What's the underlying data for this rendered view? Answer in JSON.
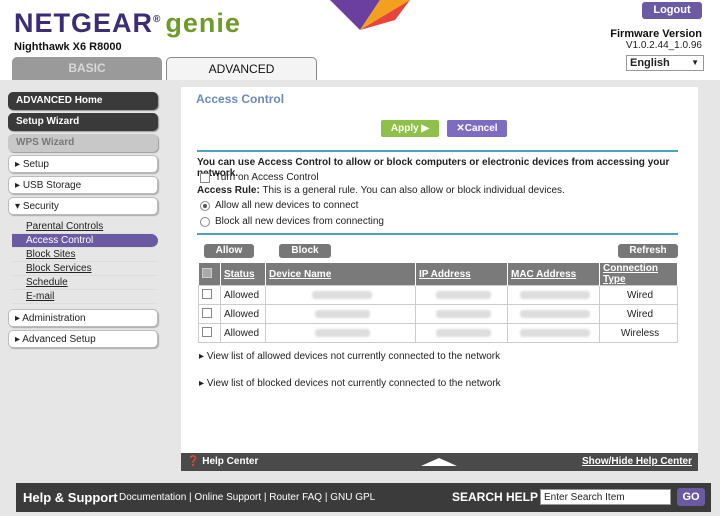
{
  "header": {
    "brand": "NETGEAR",
    "brand_mark": "®",
    "product": "genie",
    "model": "Nighthawk X6 R8000",
    "logout_label": "Logout",
    "firmware_title": "Firmware Version",
    "firmware_version": "V1.0.2.44_1.0.96",
    "language": "English"
  },
  "tabs": {
    "basic": "BASIC",
    "advanced": "ADVANCED"
  },
  "sidebar": {
    "advanced_home": "ADVANCED Home",
    "setup_wizard": "Setup Wizard",
    "wps_wizard": "WPS Wizard",
    "setup": "Setup",
    "usb_storage": "USB Storage",
    "security": "Security",
    "security_items": [
      "Parental Controls",
      "Access Control",
      "Block Sites",
      "Block Services",
      "Schedule",
      "E-mail"
    ],
    "administration": "Administration",
    "advanced_setup": "Advanced Setup"
  },
  "main": {
    "title": "Access Control",
    "apply_label": "Apply ▶",
    "cancel_label": "✕Cancel",
    "intro": "You can use Access Control to allow or block computers or electronic devices from accessing your network.",
    "turn_on_label": "Turn on Access Control",
    "access_rule_label": "Access Rule:",
    "access_rule_text": " This is a general rule. You can also allow or block individual devices.",
    "allow_all_label": "Allow all new devices to connect",
    "block_all_label": "Block all new devices from connecting",
    "allow_btn": "Allow",
    "block_btn": "Block",
    "refresh_btn": "Refresh",
    "columns": [
      "Status",
      "Device Name",
      "IP Address",
      "MAC Address",
      "Connection Type"
    ],
    "rows": [
      {
        "status": "Allowed",
        "connection": "Wired"
      },
      {
        "status": "Allowed",
        "connection": "Wired"
      },
      {
        "status": "Allowed",
        "connection": "Wireless"
      }
    ],
    "allowed_list_link": "View list of allowed devices not currently connected to the network",
    "blocked_list_link": "View list of blocked devices not currently connected to the network"
  },
  "help_bar": {
    "help_center": "Help Center",
    "show_hide": "Show/Hide Help Center"
  },
  "footer": {
    "help_support": "Help & Support",
    "links": "Documentation | Online Support | Router FAQ | GNU GPL",
    "search_help": "SEARCH HELP",
    "search_placeholder": "Enter Search Item",
    "go": "GO"
  },
  "colors": {
    "brand_purple": "#3d2d74",
    "genie_green": "#6d9b2a",
    "accent_purple": "#6b5aa2",
    "apply_green": "#8fc14a"
  }
}
